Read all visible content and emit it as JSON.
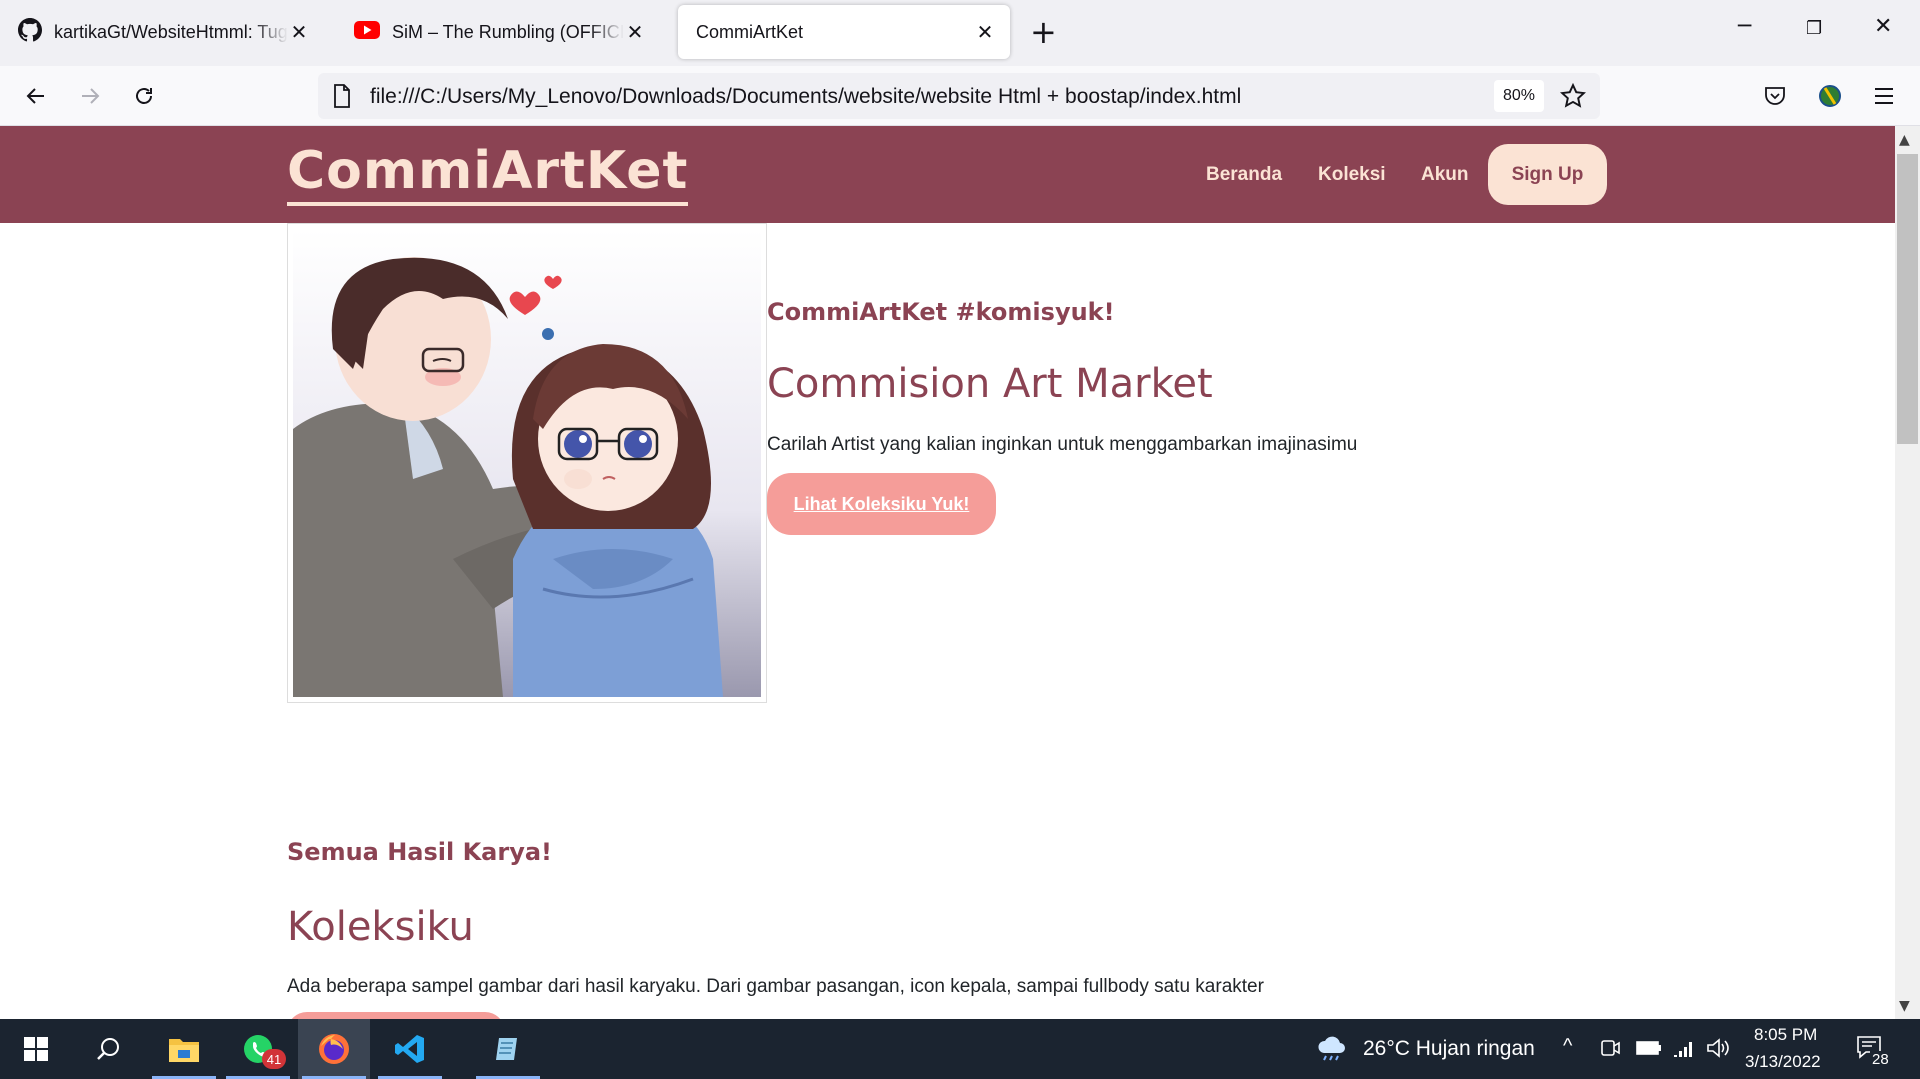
{
  "browser": {
    "tabs": [
      {
        "title": "kartikaGt/WebsiteHtmml: Tugas",
        "icon": "github-icon"
      },
      {
        "title": "SiM – The Rumbling (OFFICIAL V",
        "icon": "youtube-icon"
      },
      {
        "title": "CommiArtKet",
        "icon": "none"
      }
    ],
    "url": "file:///C:/Users/My_Lenovo/Downloads/Documents/website/website Html + boostap/index.html",
    "zoom": "80%"
  },
  "site": {
    "logo": "CommiArtKet",
    "nav": [
      "Beranda",
      "Koleksi",
      "Akun"
    ],
    "signup": "Sign Up",
    "brand_color": "#8b4353",
    "accent_color": "#f59d99",
    "cream_color": "#fbe3d4"
  },
  "hero": {
    "tagline": "CommiArtKet #komisyuk!",
    "title": "Commision Art Market",
    "description": "Carilah Artist yang kalian inginkan untuk menggambarkan imajinasimu",
    "button": "Lihat Koleksiku Yuk!"
  },
  "gallery_section": {
    "tagline": "Semua Hasil Karya!",
    "title": "Koleksiku",
    "description": "Ada beberapa sampel gambar dari hasil karyaku. Dari gambar pasangan, icon kepala, sampai fullbody satu karakter"
  },
  "taskbar": {
    "weather": "26°C  Hujan ringan",
    "time": "8:05 PM",
    "date": "3/13/2022",
    "whatsapp_badge": "41",
    "notifications": "28"
  }
}
